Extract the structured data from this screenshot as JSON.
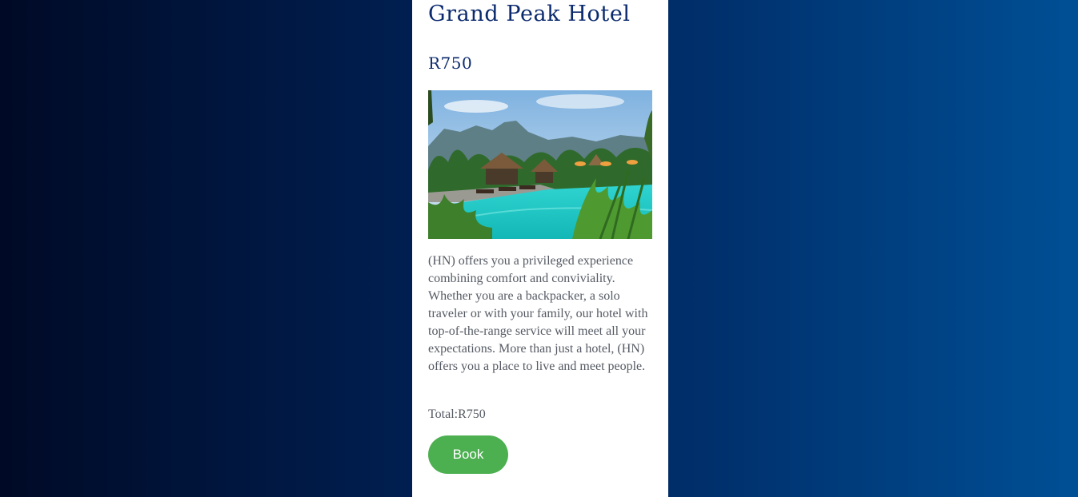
{
  "hotel": {
    "name": "Grand Peak Hotel",
    "price": "R750",
    "image_subject": "tropical resort pool with thatched-roof huts, palm trees and mountains",
    "description": "(HN) offers you a privileged experience combining comfort and conviviality. Whether you are a backpacker, a solo traveler or with your family, our hotel with top-of-the-range service will meet all your expectations. More than just a hotel, (HN) offers you a place to live and meet people.",
    "total": "Total:R750",
    "book_label": "Book"
  },
  "colors": {
    "title": "#0b2a6e",
    "button": "#4caf50",
    "text": "#555a63",
    "background_left": "#000a26",
    "background_right": "#004f95"
  }
}
